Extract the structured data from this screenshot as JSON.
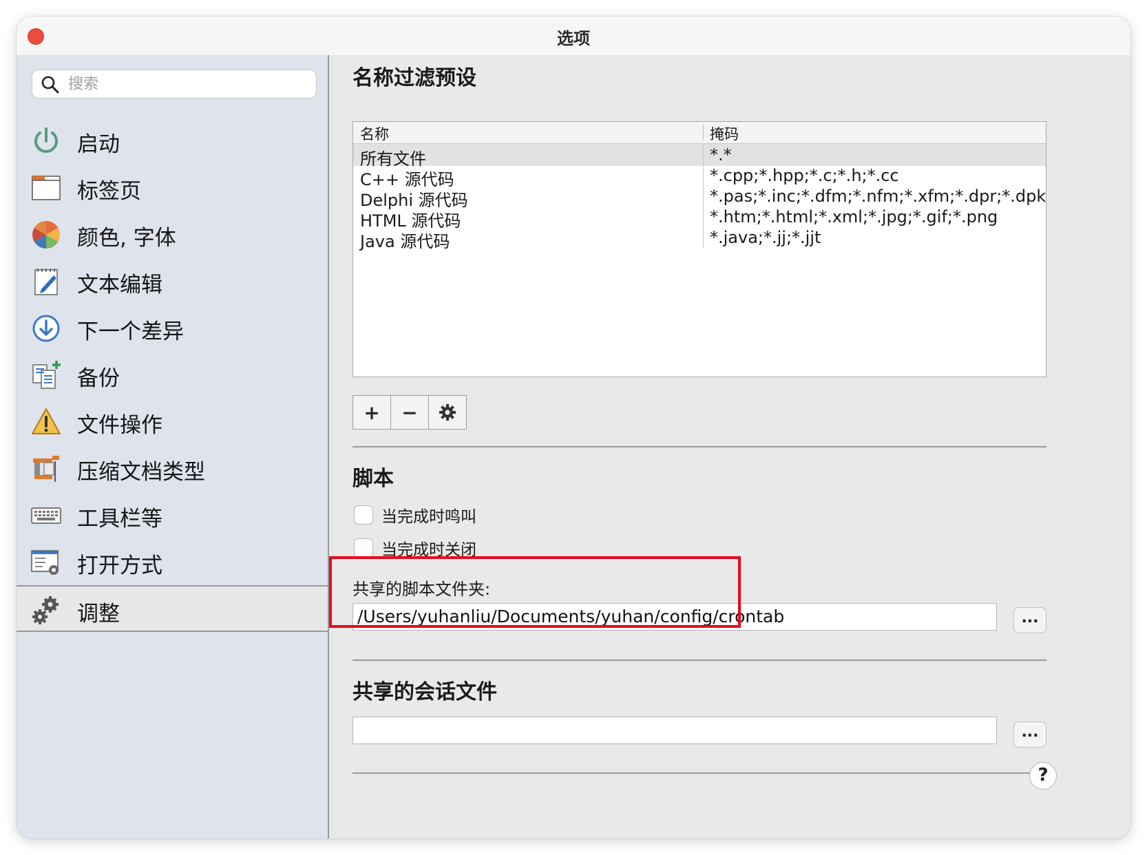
{
  "window": {
    "title": "选项"
  },
  "sidebar": {
    "search_placeholder": "搜索",
    "items": [
      {
        "label": "启动",
        "icon": "power-icon"
      },
      {
        "label": "标签页",
        "icon": "tabs-window-icon"
      },
      {
        "label": "颜色, 字体",
        "icon": "color-wheel-icon"
      },
      {
        "label": "文本编辑",
        "icon": "notepad-pencil-icon"
      },
      {
        "label": "下一个差异",
        "icon": "arrow-down-circle-icon"
      },
      {
        "label": "备份",
        "icon": "documents-plus-icon"
      },
      {
        "label": "文件操作",
        "icon": "warning-triangle-icon"
      },
      {
        "label": "压缩文档类型",
        "icon": "archive-clamp-icon"
      },
      {
        "label": "工具栏等",
        "icon": "keyboard-icon"
      },
      {
        "label": "打开方式",
        "icon": "window-gear-icon"
      },
      {
        "label": "调整",
        "icon": "gears-icon",
        "selected": true
      }
    ]
  },
  "filter_presets": {
    "heading": "名称过滤预设",
    "columns": [
      "名称",
      "掩码"
    ],
    "rows": [
      {
        "name": "所有文件",
        "mask": "*.*"
      },
      {
        "name": "C++ 源代码",
        "mask": "*.cpp;*.hpp;*.c;*.h;*.cc"
      },
      {
        "name": "Delphi 源代码",
        "mask": "*.pas;*.inc;*.dfm;*.nfm;*.xfm;*.dpr;*.dpk"
      },
      {
        "name": "HTML 源代码",
        "mask": "*.htm;*.html;*.xml;*.jpg;*.gif;*.png"
      },
      {
        "name": "Java 源代码",
        "mask": "*.java;*.jj;*.jjt"
      }
    ],
    "buttons": {
      "add": "+",
      "remove": "−",
      "settings_icon": "gear-icon"
    }
  },
  "script": {
    "heading": "脚本",
    "beep_on_finish": {
      "label": "当完成时鸣叫",
      "checked": false
    },
    "close_on_finish": {
      "label": "当完成时关闭",
      "checked": false
    },
    "shared_folder_label": "共享的脚本文件夹:",
    "shared_folder_value": "/Users/yuhanliu/Documents/yuhan/config/crontab",
    "browse_label": "..."
  },
  "session": {
    "heading": "共享的会话文件",
    "value": "",
    "browse_label": "..."
  },
  "help_label": "?",
  "colors": {
    "highlight": "#e8091d",
    "sidebar_bg": "#dee3ec",
    "close_button": "#ed4a40"
  }
}
